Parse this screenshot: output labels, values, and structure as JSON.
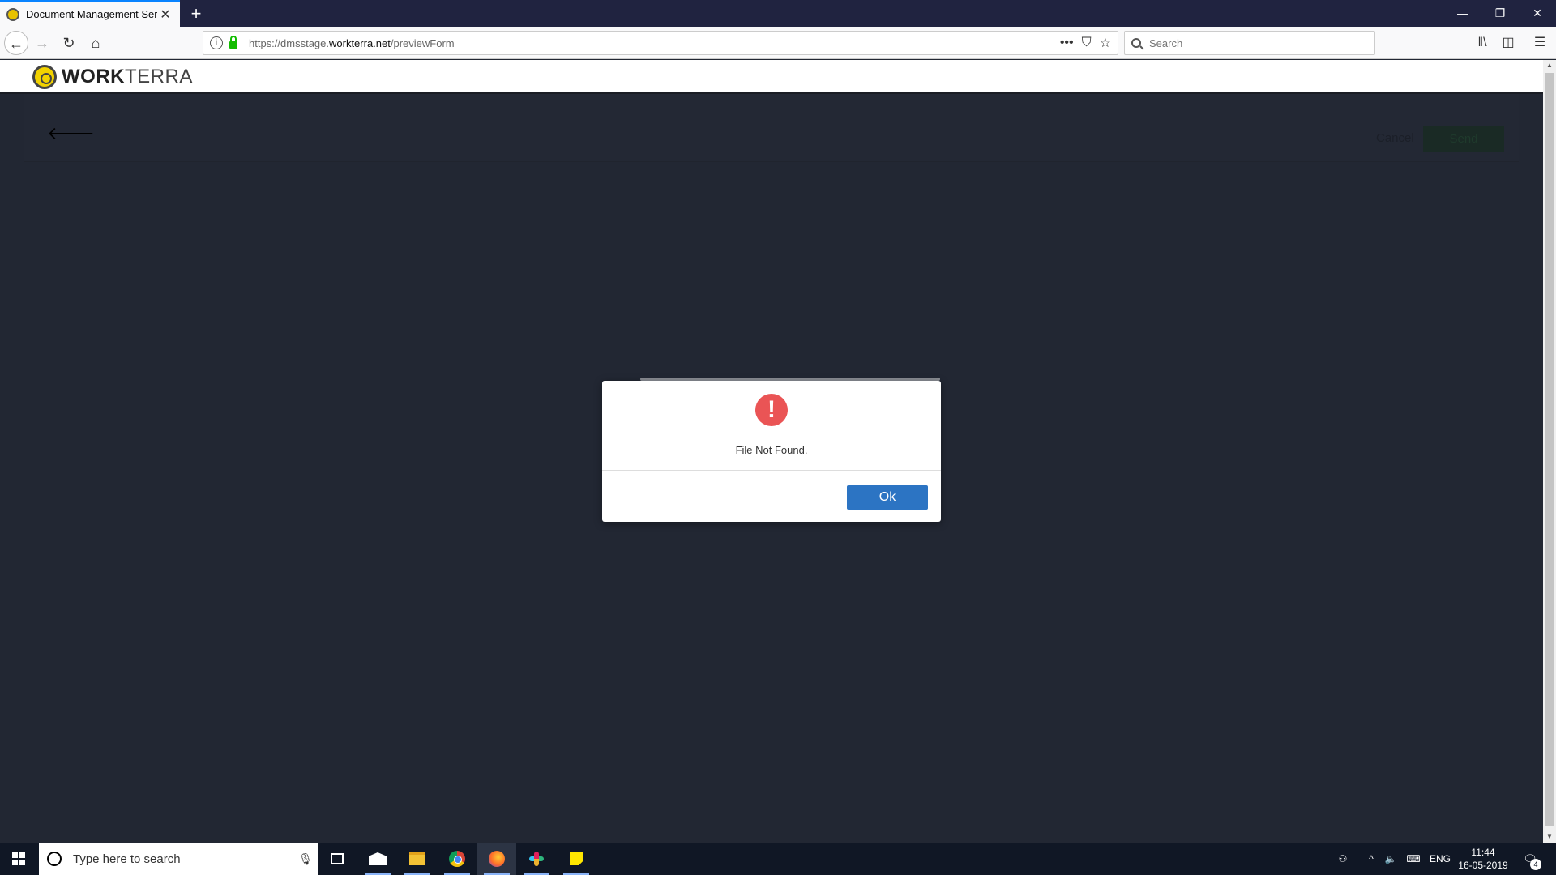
{
  "browser": {
    "tab": {
      "title": "Document Management Servic"
    },
    "url": {
      "prefix": "https://dmsstage.",
      "domain": "workterra.net",
      "path": "/previewForm"
    },
    "search_placeholder": "Search"
  },
  "app": {
    "logo": {
      "part1": "WORK",
      "part2": "TERRA"
    },
    "toolbar": {
      "cancel_label": "Cancel",
      "send_label": "Send"
    }
  },
  "modal": {
    "message": "File Not Found.",
    "ok_label": "Ok",
    "icon_color": "#ea5455",
    "button_color": "#2c74c3"
  },
  "taskbar": {
    "search_placeholder": "Type here to search",
    "language": "ENG",
    "time": "11:44",
    "date": "16-05-2019",
    "notification_count": "4",
    "apps": [
      "task-view",
      "mail",
      "file-explorer",
      "chrome",
      "firefox",
      "slack",
      "sticky-notes"
    ]
  }
}
